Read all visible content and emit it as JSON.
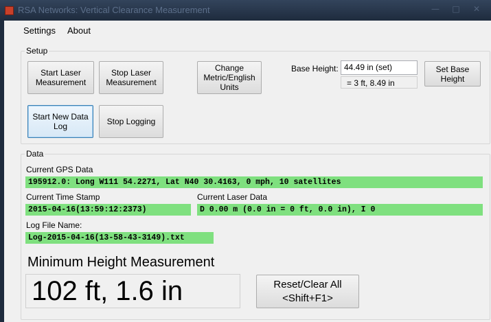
{
  "window": {
    "title": "RSA Networks: Vertical Clearance Measurement",
    "controls": [
      "—",
      "□",
      "✕"
    ]
  },
  "menu": {
    "items": [
      "Settings",
      "About"
    ]
  },
  "setup": {
    "label": "Setup",
    "start_laser": "Start Laser Measurement",
    "stop_laser": "Stop Laser Measurement",
    "change_units": "Change Metric/English Units",
    "start_log": "Start New Data Log",
    "stop_logging": "Stop Logging",
    "base_height_label": "Base Height:",
    "base_height_value": "44.49 in (set)",
    "base_height_converted": "= 3 ft, 8.49 in",
    "set_base_height": "Set Base Height"
  },
  "data": {
    "label": "Data",
    "gps_label": "Current GPS Data",
    "gps_value": "195912.0: Long W111 54.2271, Lat N40 30.4163, 0 mph, 10 satellites",
    "time_label": "Current Time Stamp",
    "time_value": "2015-04-16(13:59:12:2373)",
    "laser_label": "Current Laser Data",
    "laser_value": "D 0.00 m (0.0 in = 0 ft, 0.0 in), I 0",
    "log_label": "Log File Name:",
    "log_value": "Log-2015-04-16(13-58-43-3149).txt"
  },
  "measurement": {
    "title": "Minimum Height Measurement",
    "value": "102 ft, 1.6 in",
    "reset_line1": "Reset/Clear All",
    "reset_line2": "<Shift+F1>"
  },
  "colors": {
    "titlebar": "#1e2b3d",
    "data_highlight": "#7fe07f",
    "window_bg": "#f0f0f0"
  }
}
